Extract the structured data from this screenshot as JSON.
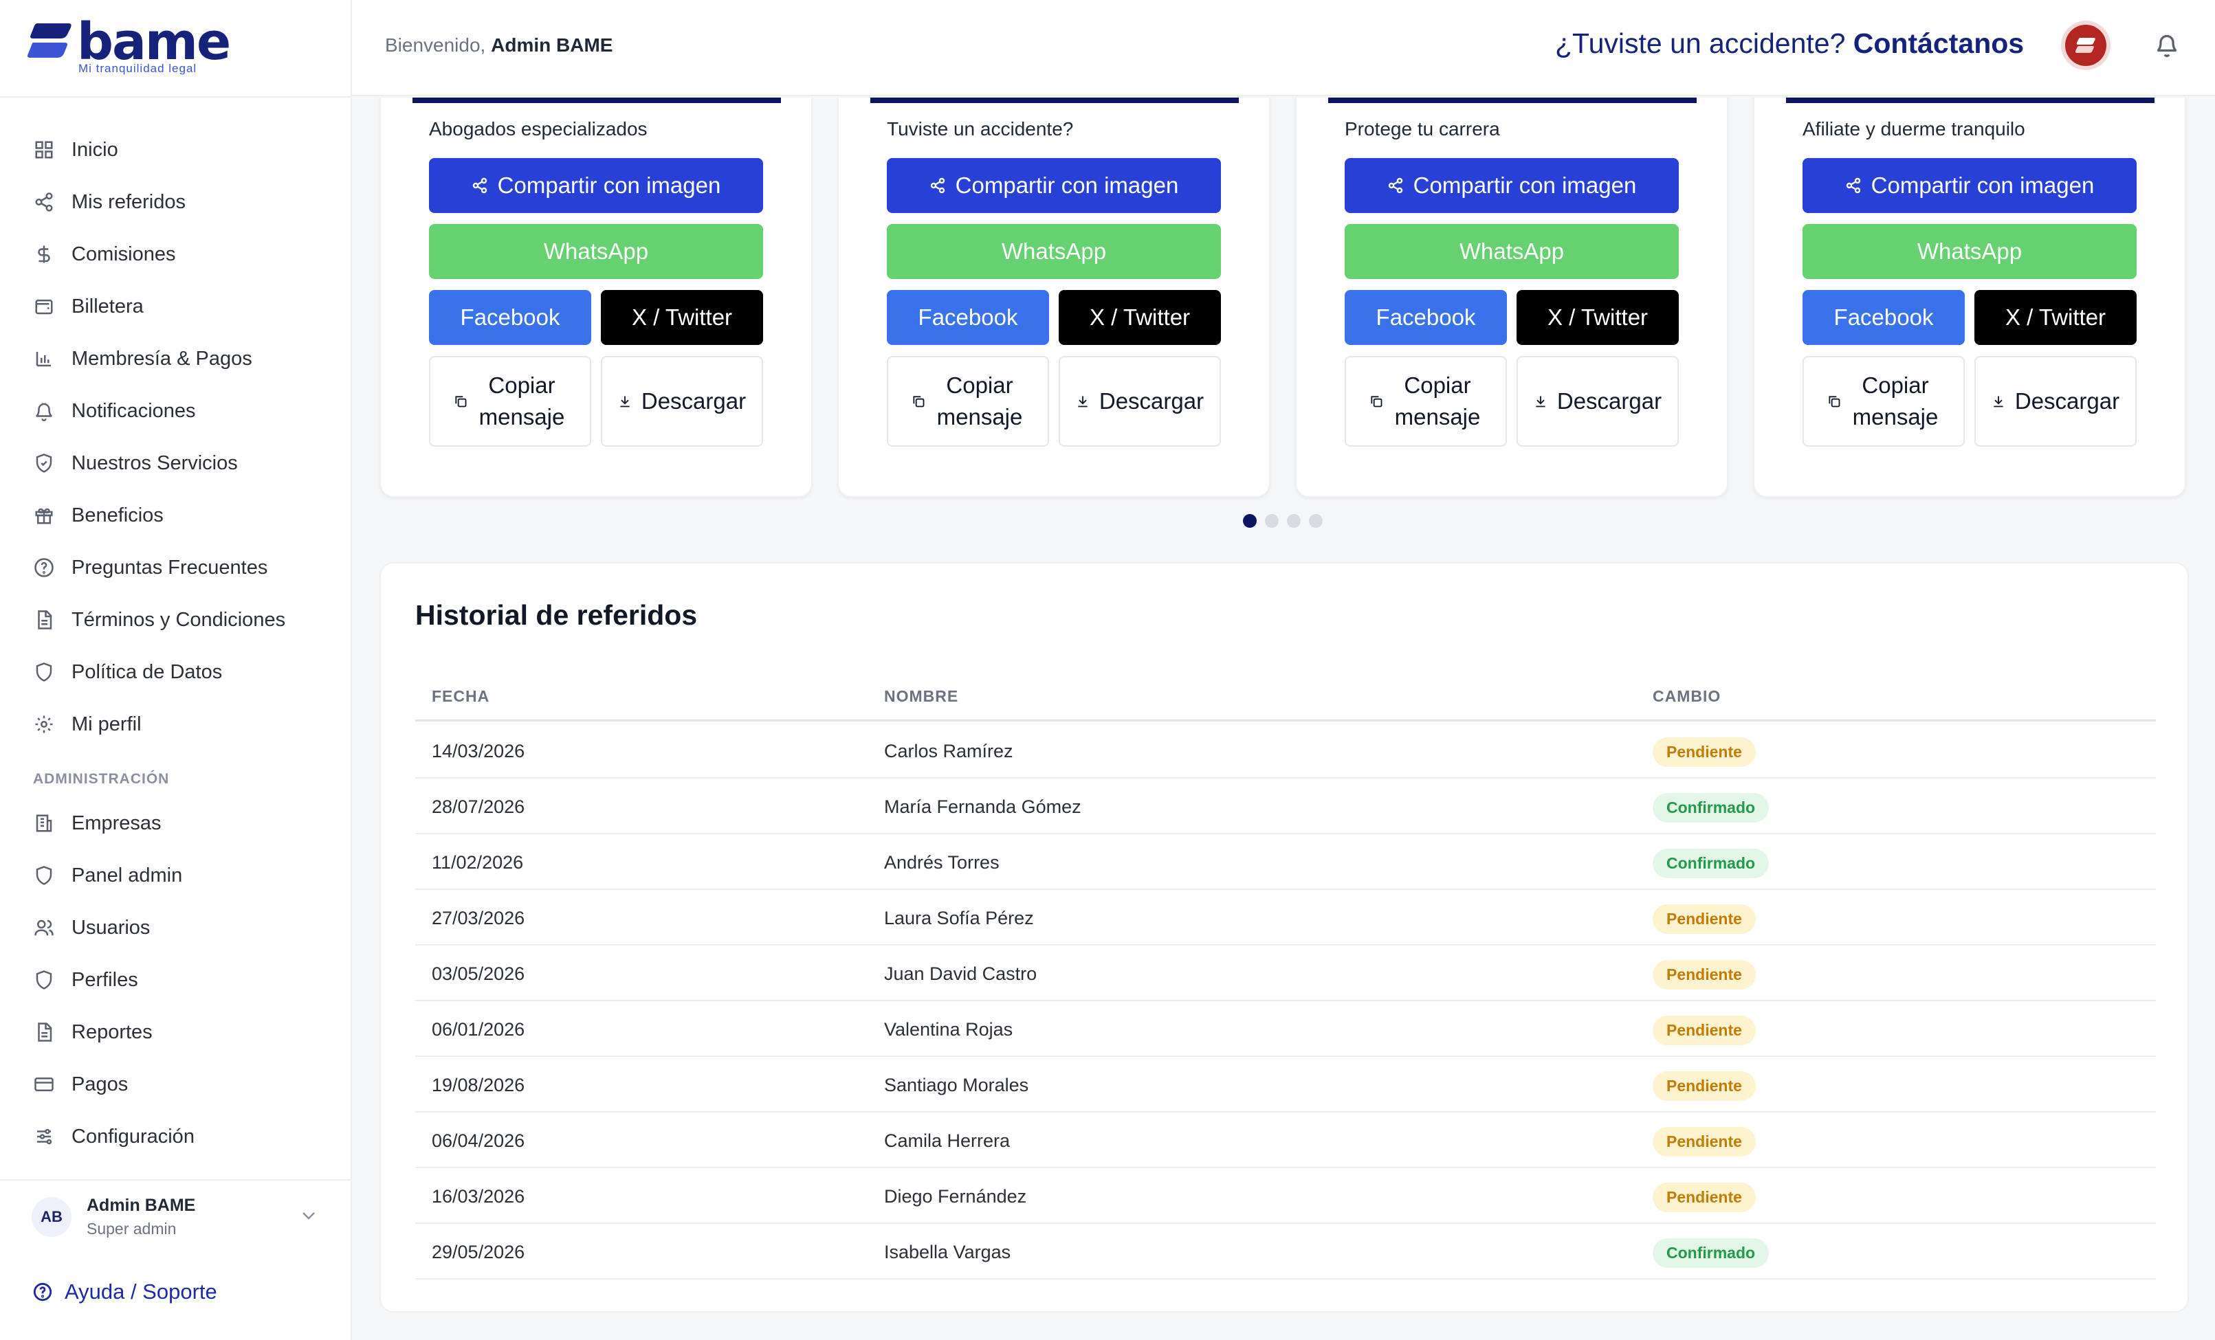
{
  "brand": {
    "name": "bame",
    "tagline": "Mi tranquilidad legal"
  },
  "header": {
    "welcome_prefix": "Bienvenido,",
    "user_name": "Admin BAME",
    "accident_question": "¿Tuviste un accidente?",
    "contact_label": "Contáctanos"
  },
  "sidebar": {
    "items": [
      {
        "label": "Inicio",
        "icon": "grid-icon"
      },
      {
        "label": "Mis referidos",
        "icon": "share-icon"
      },
      {
        "label": "Comisiones",
        "icon": "dollar-icon"
      },
      {
        "label": "Billetera",
        "icon": "wallet-icon"
      },
      {
        "label": "Membresía & Pagos",
        "icon": "bar-chart-icon"
      },
      {
        "label": "Notificaciones",
        "icon": "bell-icon"
      },
      {
        "label": "Nuestros Servicios",
        "icon": "shield-check-icon"
      },
      {
        "label": "Beneficios",
        "icon": "gift-icon"
      },
      {
        "label": "Preguntas Frecuentes",
        "icon": "help-circle-icon"
      },
      {
        "label": "Términos y Condiciones",
        "icon": "document-icon"
      },
      {
        "label": "Política de Datos",
        "icon": "shield-icon"
      },
      {
        "label": "Mi perfil",
        "icon": "gear-icon"
      }
    ],
    "admin_section_label": "ADMINISTRACIÓN",
    "admin_items": [
      {
        "label": "Empresas",
        "icon": "building-icon"
      },
      {
        "label": "Panel admin",
        "icon": "shield-icon"
      },
      {
        "label": "Usuarios",
        "icon": "users-icon"
      },
      {
        "label": "Perfiles",
        "icon": "shield-icon"
      },
      {
        "label": "Reportes",
        "icon": "document-icon"
      },
      {
        "label": "Pagos",
        "icon": "credit-card-icon"
      },
      {
        "label": "Configuración",
        "icon": "sliders-icon"
      }
    ],
    "user": {
      "initials": "AB",
      "name": "Admin BAME",
      "role": "Super admin"
    },
    "help_label": "Ayuda / Soporte"
  },
  "share_cards": [
    {
      "title": "Abogados especializados"
    },
    {
      "title": "Tuviste un accidente?"
    },
    {
      "title": "Protege tu carrera"
    },
    {
      "title": "Afiliate y duerme tranquilo"
    }
  ],
  "share_buttons": {
    "share_image": "Compartir con imagen",
    "whatsapp": "WhatsApp",
    "facebook": "Facebook",
    "twitter": "X / Twitter",
    "copy": "Copiar mensaje",
    "download": "Descargar"
  },
  "carousel": {
    "total": 4,
    "active": 1
  },
  "referrals": {
    "title": "Historial de referidos",
    "columns": [
      "FECHA",
      "NOMBRE",
      "CAMBIO"
    ],
    "rows": [
      {
        "date": "14/03/2026",
        "name": "Carlos Ramírez",
        "status": "Pendiente"
      },
      {
        "date": "28/07/2026",
        "name": "María Fernanda Gómez",
        "status": "Confirmado"
      },
      {
        "date": "11/02/2026",
        "name": "Andrés Torres",
        "status": "Confirmado"
      },
      {
        "date": "27/03/2026",
        "name": "Laura Sofía Pérez",
        "status": "Pendiente"
      },
      {
        "date": "03/05/2026",
        "name": "Juan David Castro",
        "status": "Pendiente"
      },
      {
        "date": "06/01/2026",
        "name": "Valentina Rojas",
        "status": "Pendiente"
      },
      {
        "date": "19/08/2026",
        "name": "Santiago Morales",
        "status": "Pendiente"
      },
      {
        "date": "06/04/2026",
        "name": "Camila Herrera",
        "status": "Pendiente"
      },
      {
        "date": "16/03/2026",
        "name": "Diego Fernández",
        "status": "Pendiente"
      },
      {
        "date": "29/05/2026",
        "name": "Isabella Vargas",
        "status": "Confirmado"
      }
    ]
  },
  "colors": {
    "brand_navy": "#16237a",
    "primary_blue": "#2741d6",
    "whatsapp_green": "#66d26f",
    "facebook_blue": "#3a72ec",
    "pending_text": "#c47a06",
    "confirmed_text": "#23994a"
  }
}
